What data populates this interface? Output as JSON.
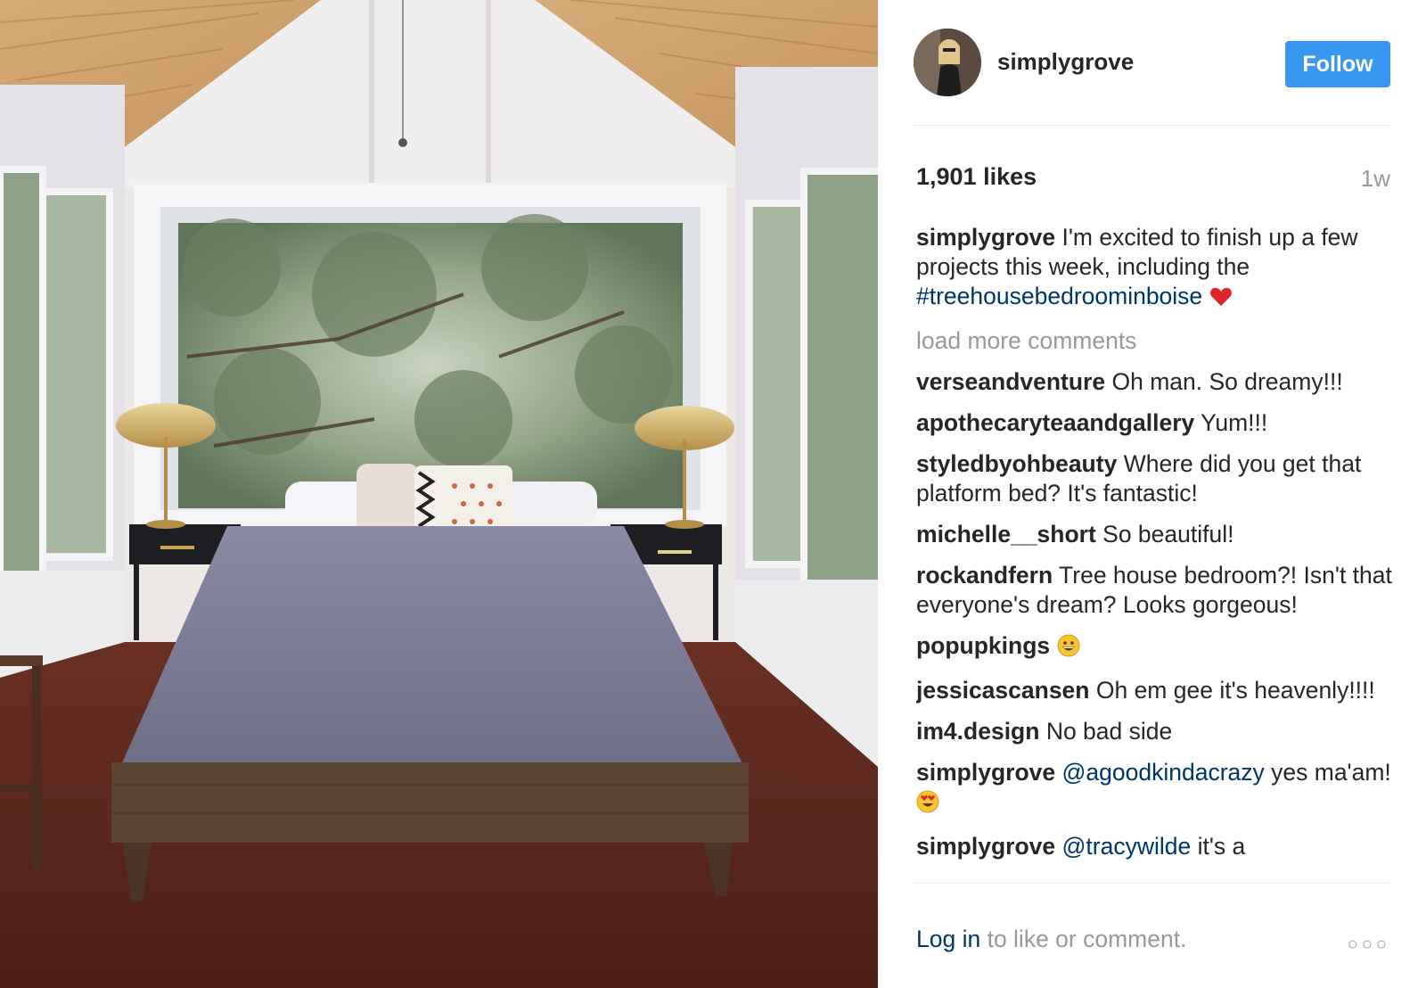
{
  "post": {
    "username": "simplygrove",
    "follow_label": "Follow",
    "likes": "1,901 likes",
    "age": "1w",
    "caption": {
      "user": "simplygrove",
      "text": "I'm excited to finish up a few projects this week, including the",
      "hashtag": "#treehousebedroominboise"
    },
    "load_more": "load more comments",
    "comments": [
      {
        "user": "verseandventure",
        "text": "Oh man. So dreamy!!!"
      },
      {
        "user": "apothecaryteaandgallery",
        "text": "Yum!!!"
      },
      {
        "user": "styledbyohbeauty",
        "text": "Where did you get that platform bed? It's fantastic!"
      },
      {
        "user": "michelle__short",
        "text": "So beautiful!"
      },
      {
        "user": "rockandfern",
        "text": "Tree house bedroom?! Isn't that everyone's dream? Looks gorgeous!"
      },
      {
        "user": "popupkings",
        "text": ""
      },
      {
        "user": "jessicascansen",
        "text": "Oh em gee it's heavenly!!!!"
      },
      {
        "user": "im4.design",
        "text": "No bad side"
      },
      {
        "user": "simplygrove",
        "mention": "@agoodkindacrazy",
        "text": "yes ma'am!"
      },
      {
        "user": "simplygrove",
        "mention": "@tracywilde",
        "text": "it's a"
      }
    ],
    "footer": {
      "login_label": "Log in",
      "login_suffix": "to like or comment.",
      "more_label": "○○○"
    }
  },
  "icons": [
    "heart-emoji",
    "grinning-emoji",
    "heart-eyes-emoji",
    "more-options-icon"
  ],
  "colors": {
    "follow_button": "#3897f0",
    "link": "#003569",
    "muted": "#999999",
    "text": "#262626"
  }
}
